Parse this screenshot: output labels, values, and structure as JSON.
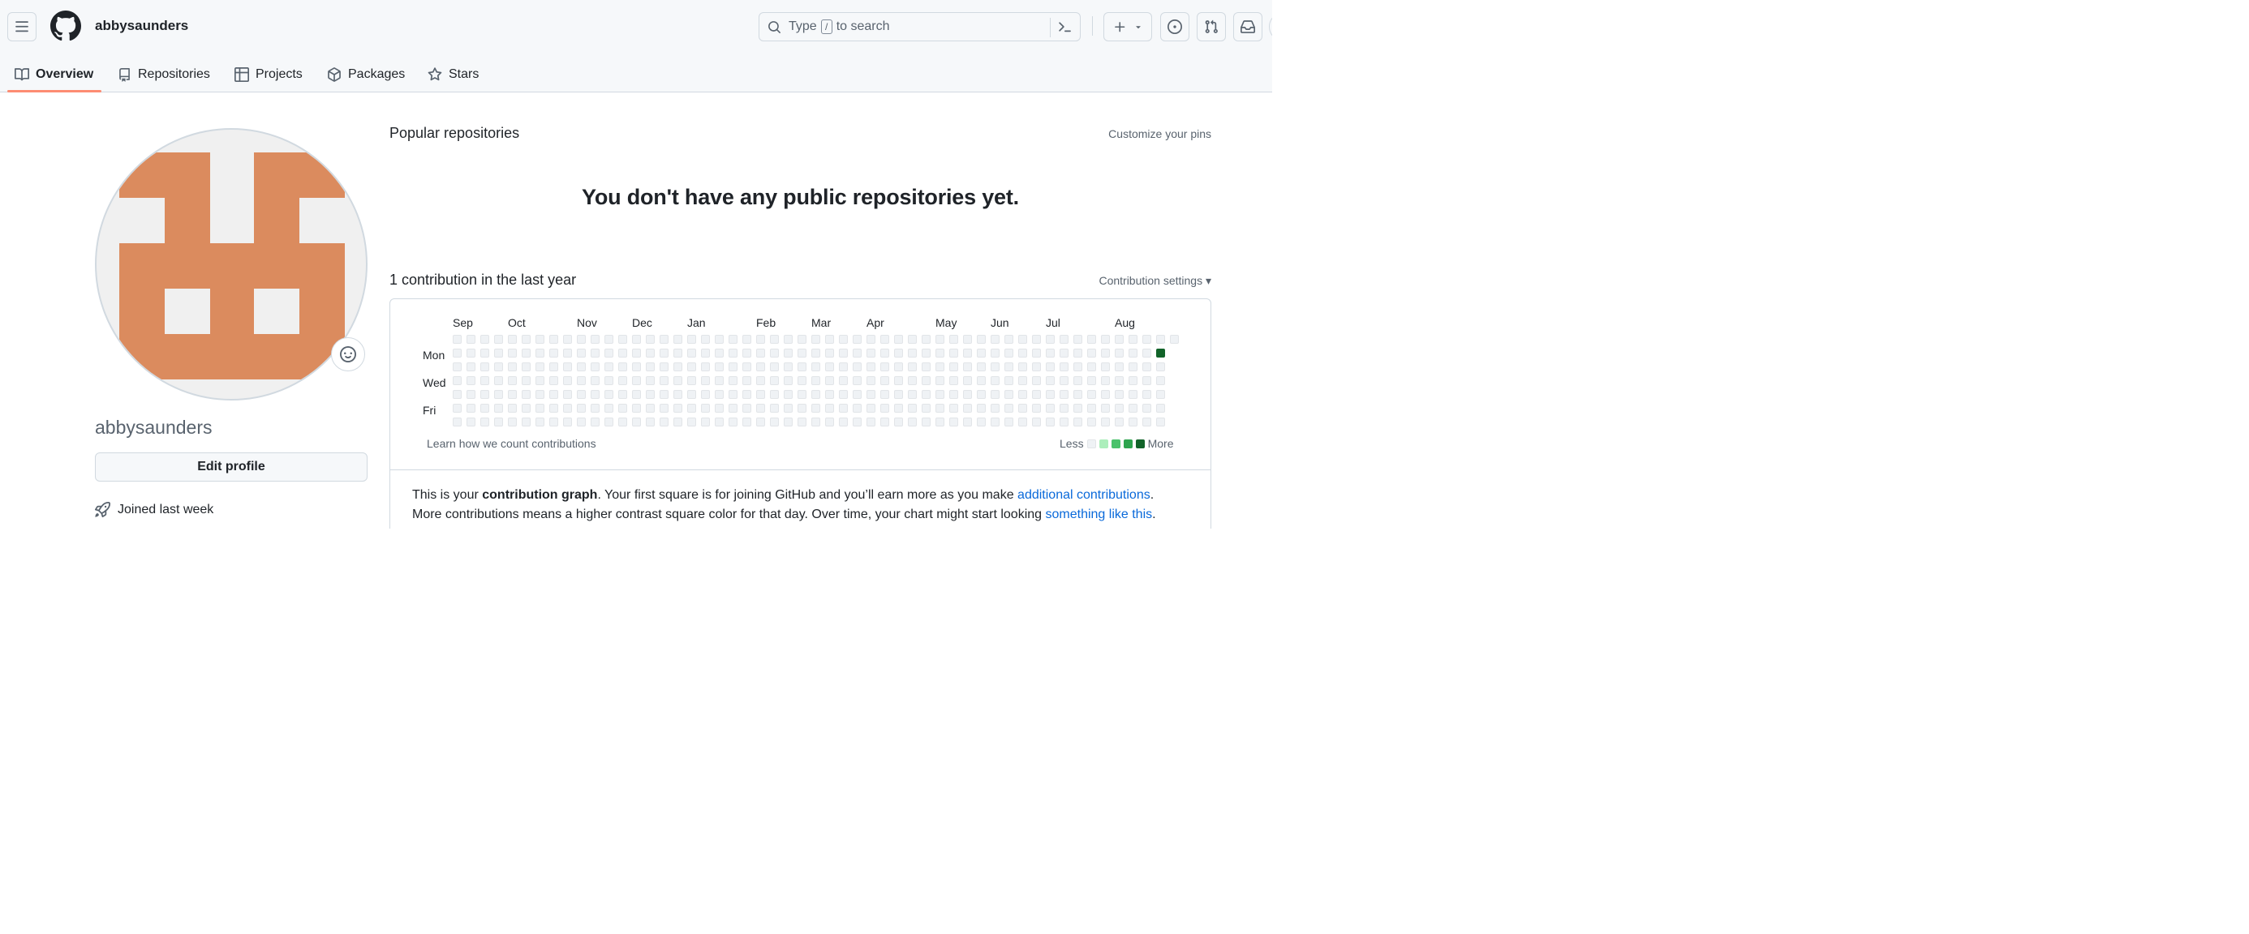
{
  "header": {
    "username": "abbysaunders",
    "search": {
      "prefix": "Type",
      "key": "/",
      "suffix": "to search"
    }
  },
  "tabs": [
    {
      "label": "Overview",
      "icon": "book-icon",
      "active": true
    },
    {
      "label": "Repositories",
      "icon": "repo-icon",
      "active": false
    },
    {
      "label": "Projects",
      "icon": "table-icon",
      "active": false
    },
    {
      "label": "Packages",
      "icon": "package-icon",
      "active": false
    },
    {
      "label": "Stars",
      "icon": "star-icon",
      "active": false
    }
  ],
  "profile": {
    "name": "abbysaunders",
    "edit_label": "Edit profile",
    "joined": "Joined last week"
  },
  "popular": {
    "title": "Popular repositories",
    "customize": "Customize your pins",
    "empty": "You don't have any public repositories yet."
  },
  "contributions": {
    "title": "1 contribution in the last year",
    "settings": "Contribution settings ▾",
    "months": [
      "Sep",
      "Oct",
      "Nov",
      "Dec",
      "Jan",
      "Feb",
      "Mar",
      "Apr",
      "May",
      "Jun",
      "Jul",
      "Aug"
    ],
    "days": [
      "Mon",
      "Wed",
      "Fri"
    ],
    "learn": "Learn how we count contributions",
    "less": "Less",
    "more": "More",
    "weeks": 53,
    "highlight": {
      "week": 51,
      "day": 1,
      "level": 4
    },
    "colors": {
      "empty": "#eff2f5",
      "level1": "#aceebb",
      "level2": "#4ac26b",
      "level3": "#2da44e",
      "level4": "#116329"
    }
  },
  "explain": {
    "p1_a": "This is your ",
    "p1_b": "contribution graph",
    "p1_c": ". Your first square is for joining GitHub and you’ll earn more as you make ",
    "p1_link": "additional contributions",
    "p1_d": ".",
    "p2_a": "More contributions means a higher contrast square color for that day. Over time, your chart might start looking ",
    "p2_link": "something like this",
    "p2_b": "."
  }
}
